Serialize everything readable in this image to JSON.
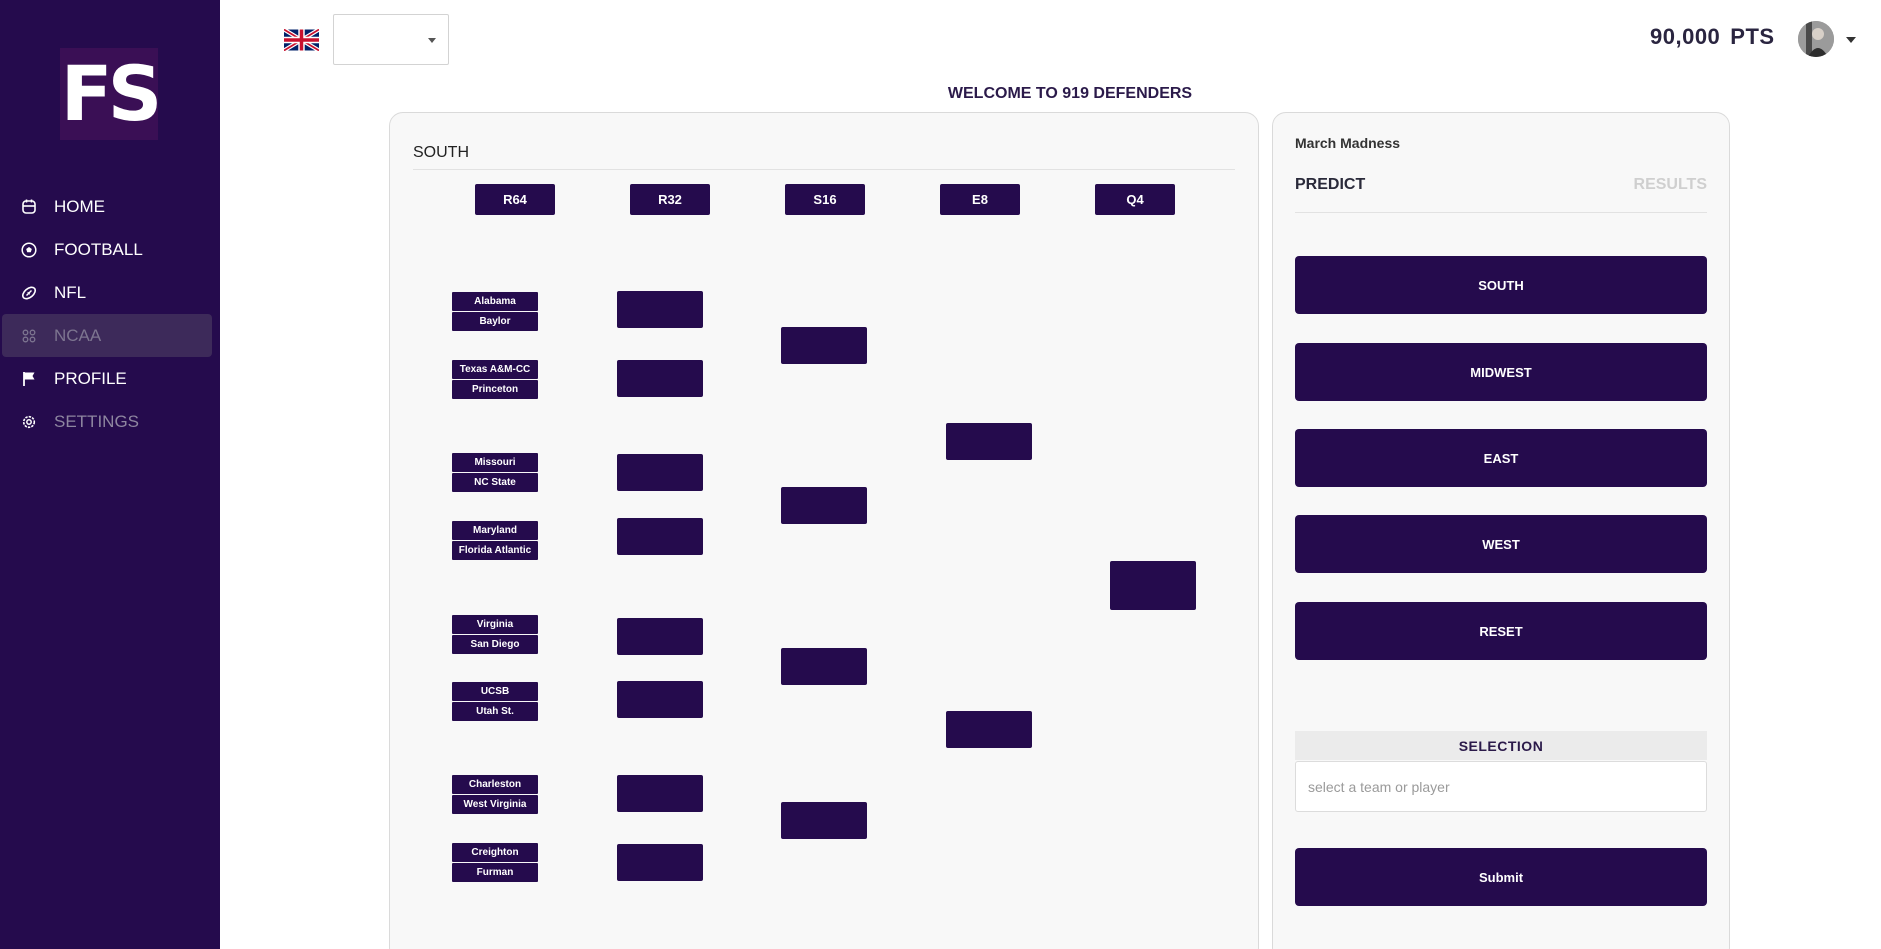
{
  "app": {
    "logo_text": "FS"
  },
  "sidebar": {
    "items": [
      {
        "label": "HOME",
        "icon": "calendar-icon"
      },
      {
        "label": "FOOTBALL",
        "icon": "soccer-ball-icon"
      },
      {
        "label": "NFL",
        "icon": "football-icon"
      },
      {
        "label": "NCAA",
        "icon": "grid-dots-icon",
        "active": true
      },
      {
        "label": "PROFILE",
        "icon": "flag-icon"
      },
      {
        "label": "SETTINGS",
        "icon": "gear-icon"
      }
    ]
  },
  "header": {
    "language_value": "",
    "points_value": "90,000",
    "points_unit": "PTS",
    "welcome": "WELCOME TO 919 DEFENDERS"
  },
  "bracket": {
    "region": "SOUTH",
    "rounds": [
      "R64",
      "R32",
      "S16",
      "E8",
      "Q4"
    ],
    "matchups": [
      [
        "Alabama",
        "Baylor"
      ],
      [
        "Texas A&M-CC",
        "Princeton"
      ],
      [
        "Missouri",
        "NC State"
      ],
      [
        "Maryland",
        "Florida Atlantic"
      ],
      [
        "Virginia",
        "San Diego"
      ],
      [
        "UCSB",
        "Utah St."
      ],
      [
        "Charleston",
        "West Virginia"
      ],
      [
        "Creighton",
        "Furman"
      ]
    ]
  },
  "panel": {
    "title": "March Madness",
    "tab_predict": "PREDICT",
    "tab_results": "RESULTS",
    "buttons": [
      "SOUTH",
      "MIDWEST",
      "EAST",
      "WEST",
      "RESET"
    ],
    "selection_label": "SELECTION",
    "selection_placeholder": "select a team or player",
    "submit_label": "Submit"
  },
  "colors": {
    "brand": "#250b4d",
    "sidebar_active": "#3d2a5a"
  }
}
